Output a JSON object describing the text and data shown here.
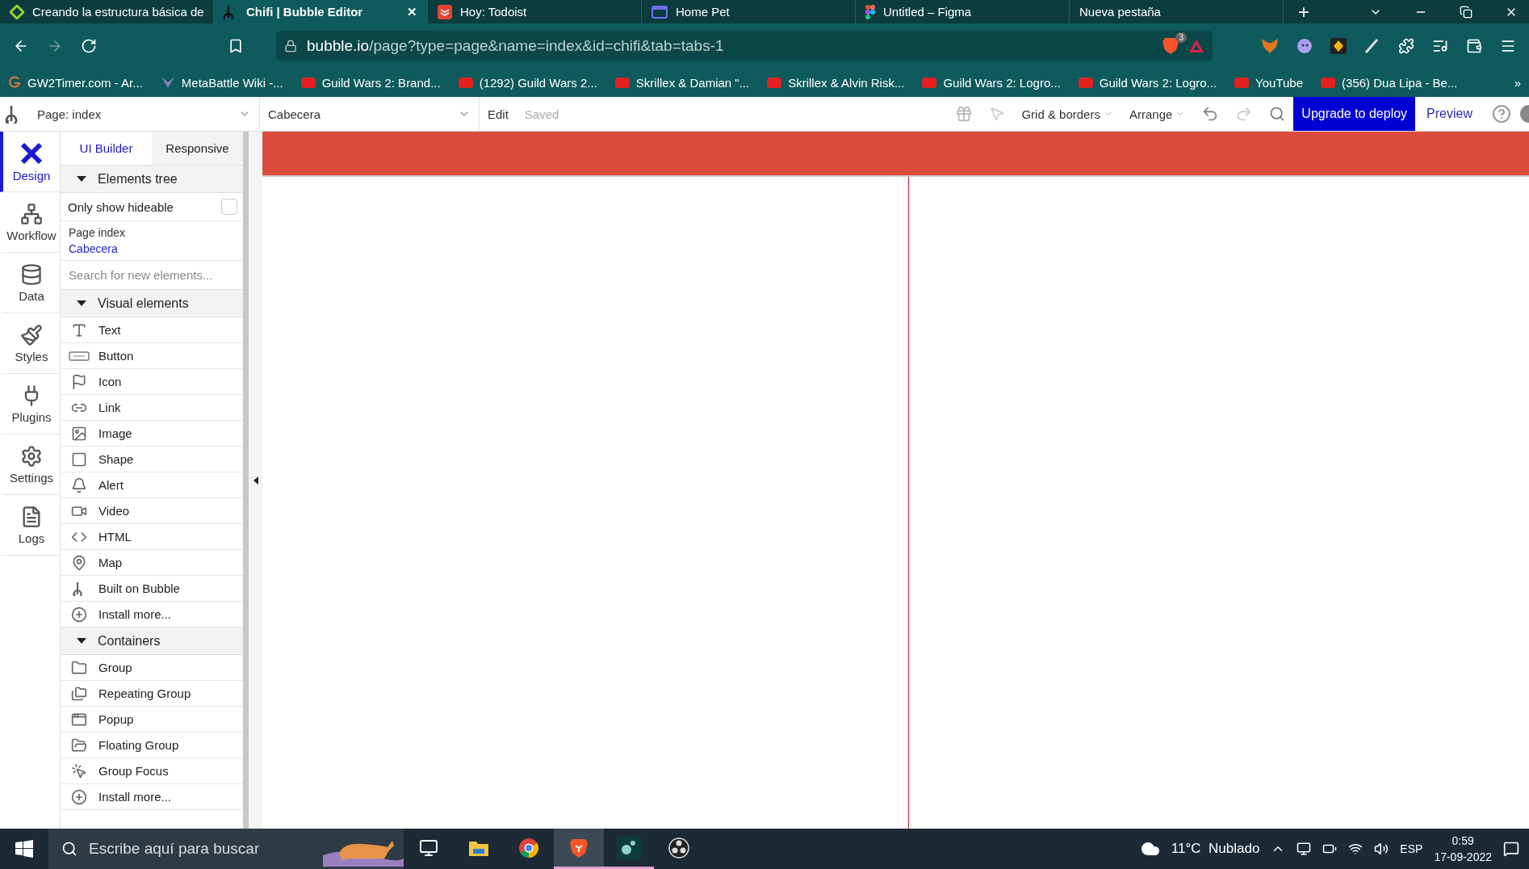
{
  "browser": {
    "tabs": [
      {
        "title": "Creando la estructura básica de",
        "selected": false
      },
      {
        "title": "Chifi | Bubble Editor",
        "selected": true,
        "close": "✕"
      },
      {
        "title": "Hoy: Todoist",
        "selected": false
      },
      {
        "title": "Home Pet",
        "selected": false
      },
      {
        "title": "Untitled – Figma",
        "selected": false
      },
      {
        "title": "Nueva pestaña",
        "selected": false
      }
    ],
    "new_tab": "+",
    "url": {
      "host": "bubble.io",
      "path": "/page?type=page&name=index&id=chifi&tab=tabs-1"
    },
    "shield_count": "3",
    "bookmarks": [
      "GW2Timer.com - Ar...",
      "MetaBattle Wiki -...",
      "Guild Wars 2: Brand...",
      "(1292) Guild Wars 2...",
      "Skrillex & Damian \"...",
      "Skrillex & Alvin Risk...",
      "Guild Wars 2: Logro...",
      "Guild Wars 2: Logro...",
      "YouTube",
      "(356) Dua Lipa - Be..."
    ],
    "more_bookmarks": "»"
  },
  "editor": {
    "page_select": "Page: index",
    "element_select": "Cabecera",
    "edit": "Edit",
    "saved": "Saved",
    "grid": "Grid & borders",
    "arrange": "Arrange",
    "upgrade": "Upgrade to deploy",
    "preview": "Preview"
  },
  "rail": [
    {
      "label": "Design",
      "selected": true
    },
    {
      "label": "Workflow",
      "selected": false
    },
    {
      "label": "Data",
      "selected": false
    },
    {
      "label": "Styles",
      "selected": false
    },
    {
      "label": "Plugins",
      "selected": false
    },
    {
      "label": "Settings",
      "selected": false
    },
    {
      "label": "Logs",
      "selected": false
    }
  ],
  "panel": {
    "tabs": [
      {
        "label": "UI Builder",
        "selected": true
      },
      {
        "label": "Responsive",
        "selected": false
      }
    ],
    "tree": {
      "title": "Elements tree",
      "expanded": true,
      "hideable_label": "Only show hideable",
      "hideable_checked": false,
      "items": [
        {
          "label": "Page index",
          "selected": false
        },
        {
          "label": "Cabecera",
          "selected": true
        }
      ]
    },
    "search": {
      "placeholder": "Search for new elements..."
    },
    "sections": [
      {
        "title": "Visual elements",
        "expanded": true,
        "items": [
          {
            "label": "Text",
            "kind": "text"
          },
          {
            "label": "Button",
            "kind": "button"
          },
          {
            "label": "Icon",
            "kind": "icon"
          },
          {
            "label": "Link",
            "kind": "link"
          },
          {
            "label": "Image",
            "kind": "image"
          },
          {
            "label": "Shape",
            "kind": "shape"
          },
          {
            "label": "Alert",
            "kind": "alert"
          },
          {
            "label": "Video",
            "kind": "video"
          },
          {
            "label": "HTML",
            "kind": "html"
          },
          {
            "label": "Map",
            "kind": "map"
          },
          {
            "label": "Built on Bubble",
            "kind": "bubble"
          },
          {
            "label": "Install more...",
            "kind": "install"
          }
        ]
      },
      {
        "title": "Containers",
        "expanded": true,
        "items": [
          {
            "label": "Group",
            "kind": "group"
          },
          {
            "label": "Repeating Group",
            "kind": "repeating"
          },
          {
            "label": "Popup",
            "kind": "popup"
          },
          {
            "label": "Floating Group",
            "kind": "floating"
          },
          {
            "label": "Group Focus",
            "kind": "focus"
          },
          {
            "label": "Install more...",
            "kind": "install"
          }
        ]
      }
    ]
  },
  "taskbar": {
    "search_placeholder": "Escribe aquí para buscar",
    "apps": [
      {
        "kind": "taskview",
        "active": false,
        "open": false
      },
      {
        "kind": "explorer",
        "active": false,
        "open": false
      },
      {
        "kind": "chrome",
        "active": false,
        "open": false
      },
      {
        "kind": "brave",
        "active": true,
        "open": true
      },
      {
        "kind": "app",
        "active": false,
        "open": true
      },
      {
        "kind": "obs",
        "active": false,
        "open": false
      }
    ],
    "weather": "11°C  Nublado",
    "language": "ESP",
    "time": "0:59",
    "date": "17-09-2022"
  }
}
